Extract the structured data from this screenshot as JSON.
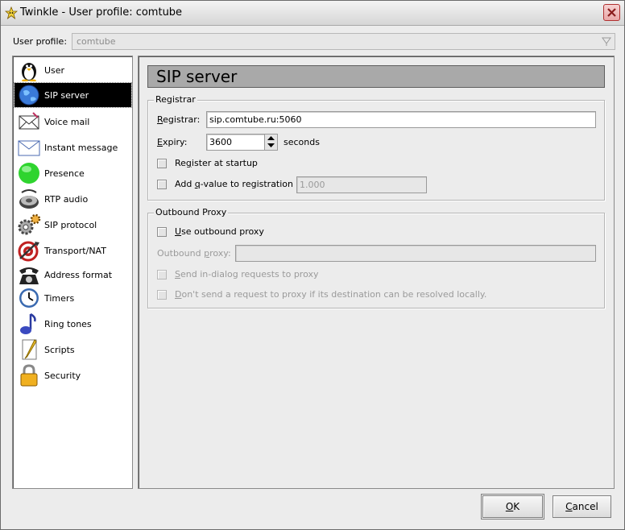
{
  "window": {
    "title": "Twinkle - User profile: comtube",
    "title_icon": "star-icon",
    "close_icon": "close-icon"
  },
  "profile": {
    "label": "User profile:",
    "value": "comtube"
  },
  "sidebar": {
    "items": [
      {
        "label": "User",
        "icon": "penguin-icon",
        "selected": false
      },
      {
        "label": "SIP server",
        "icon": "globe-icon",
        "selected": true
      },
      {
        "label": "Voice mail",
        "icon": "envelope-icon",
        "selected": false
      },
      {
        "label": "Instant message",
        "icon": "message-icon",
        "selected": false
      },
      {
        "label": "Presence",
        "icon": "presence-icon",
        "selected": false
      },
      {
        "label": "RTP audio",
        "icon": "speaker-icon",
        "selected": false
      },
      {
        "label": "SIP protocol",
        "icon": "gears-icon",
        "selected": false
      },
      {
        "label": "Transport/NAT",
        "icon": "target-icon",
        "selected": false
      },
      {
        "label": "Address format",
        "icon": "telephone-icon",
        "selected": false
      },
      {
        "label": "Timers",
        "icon": "clock-icon",
        "selected": false
      },
      {
        "label": "Ring tones",
        "icon": "music-note-icon",
        "selected": false
      },
      {
        "label": "Scripts",
        "icon": "script-icon",
        "selected": false
      },
      {
        "label": "Security",
        "icon": "lock-icon",
        "selected": false
      }
    ]
  },
  "page": {
    "heading": "SIP server",
    "registrar_group": {
      "title": "Registrar",
      "registrar_label_underlined": "R",
      "registrar_label_rest": "egistrar:",
      "registrar_value": "sip.comtube.ru:5060",
      "expiry_label_underlined": "E",
      "expiry_label_rest": "xpiry:",
      "expiry_value": "3600",
      "expiry_unit": "seconds",
      "register_at_startup_pre": "Re",
      "register_at_startup_underlined": "g",
      "register_at_startup_post": "ister at startup",
      "register_at_startup_checked": false,
      "q_value_pre": "Add ",
      "q_value_underlined": "q",
      "q_value_post": "-value to registration",
      "q_value_checked": false,
      "q_value_value": "1.000"
    },
    "proxy_group": {
      "title": "Outbound Proxy",
      "use_proxy_underlined": "U",
      "use_proxy_rest": "se outbound proxy",
      "use_proxy_checked": false,
      "proxy_label_pre": "Outbound ",
      "proxy_label_underlined": "p",
      "proxy_label_post": "roxy:",
      "proxy_value": "",
      "in_dialog_underlined": "S",
      "in_dialog_rest": "end in-dialog requests to proxy",
      "in_dialog_checked": false,
      "dont_send_underlined": "D",
      "dont_send_rest": "on't send a request to proxy if its destination can be resolved locally.",
      "dont_send_checked": false
    }
  },
  "buttons": {
    "ok_underlined": "O",
    "ok_rest": "K",
    "cancel_underlined": "C",
    "cancel_rest": "ancel"
  }
}
